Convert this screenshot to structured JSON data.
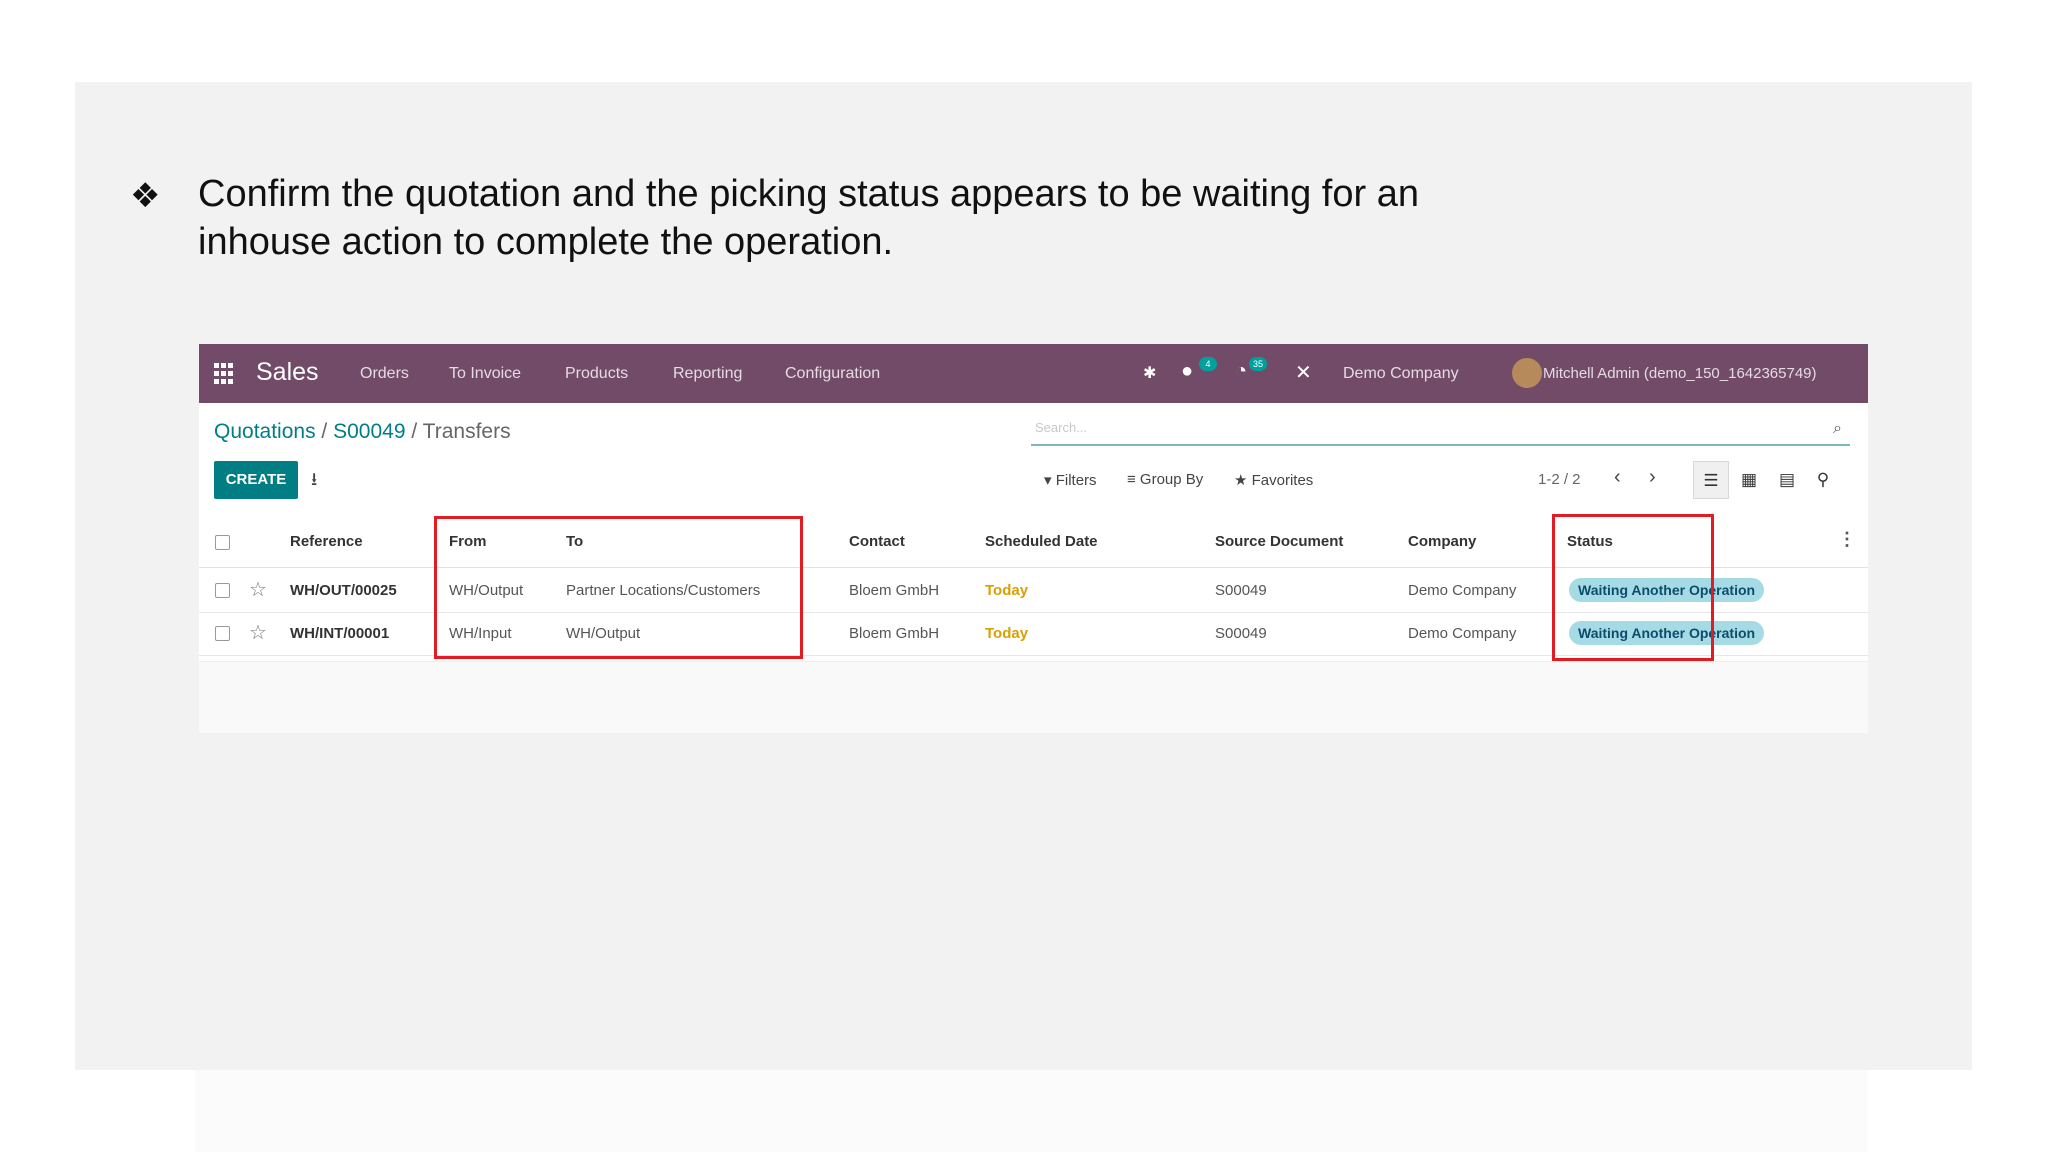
{
  "slide": {
    "bullet_glyph": "❖",
    "bullet_text": "Confirm the quotation and the picking status appears to be waiting for an inhouse action to complete the operation."
  },
  "topbar": {
    "app_name": "Sales",
    "menu": [
      "Orders",
      "To Invoice",
      "Products",
      "Reporting",
      "Configuration"
    ],
    "messages_count": "4",
    "activities_count": "35",
    "company": "Demo Company",
    "user": "Mitchell Admin (demo_150_1642365749)"
  },
  "breadcrumb": {
    "root": "Quotations",
    "order": "S00049",
    "current": "Transfers",
    "sep": "/"
  },
  "search": {
    "placeholder": "Search..."
  },
  "control": {
    "create_label": "CREATE",
    "filters": "Filters",
    "group_by": "Group By",
    "favorites": "Favorites",
    "pager": "1-2 / 2"
  },
  "table": {
    "columns": [
      "Reference",
      "From",
      "To",
      "Contact",
      "Scheduled Date",
      "Source Document",
      "Company",
      "Status"
    ],
    "rows": [
      {
        "reference": "WH/OUT/00025",
        "from": "WH/Output",
        "to": "Partner Locations/Customers",
        "contact": "Bloem GmbH",
        "scheduled": "Today",
        "source": "S00049",
        "company": "Demo Company",
        "status": "Waiting Another Operation"
      },
      {
        "reference": "WH/INT/00001",
        "from": "WH/Input",
        "to": "WH/Output",
        "contact": "Bloem GmbH",
        "scheduled": "Today",
        "source": "S00049",
        "company": "Demo Company",
        "status": "Waiting Another Operation"
      }
    ]
  },
  "colors": {
    "topbar": "#714b67",
    "primary": "#017e84",
    "highlight_box": "#e31b23",
    "status_badge": "#a6dbe6"
  }
}
